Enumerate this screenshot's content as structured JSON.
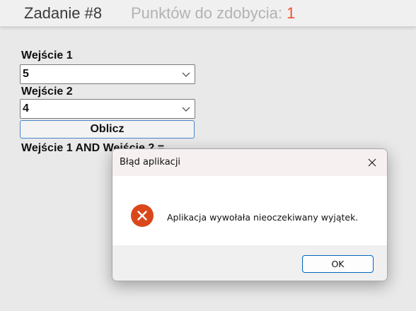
{
  "header": {
    "task_title": "Zadanie #8",
    "points_label": "Punktów do zdobycia: ",
    "points_value": "1",
    "points_color": "#e8542b"
  },
  "form": {
    "input1": {
      "label": "Wejście 1",
      "value": "5",
      "icon": "chevron-down-icon"
    },
    "input2": {
      "label": "Wejście 2",
      "value": "4",
      "icon": "chevron-down-icon"
    },
    "calculate_label": "Oblicz",
    "result_label": "Wejście 1 AND Wejście 2 ="
  },
  "dialog": {
    "title": "Błąd aplikacji",
    "message": "Aplikacja wywołała nieoczekiwany wyjątek.",
    "ok_label": "OK",
    "icon": "error-icon",
    "close_icon": "close-icon",
    "icon_color": "#d9471a",
    "accent_color": "#0067c0"
  }
}
